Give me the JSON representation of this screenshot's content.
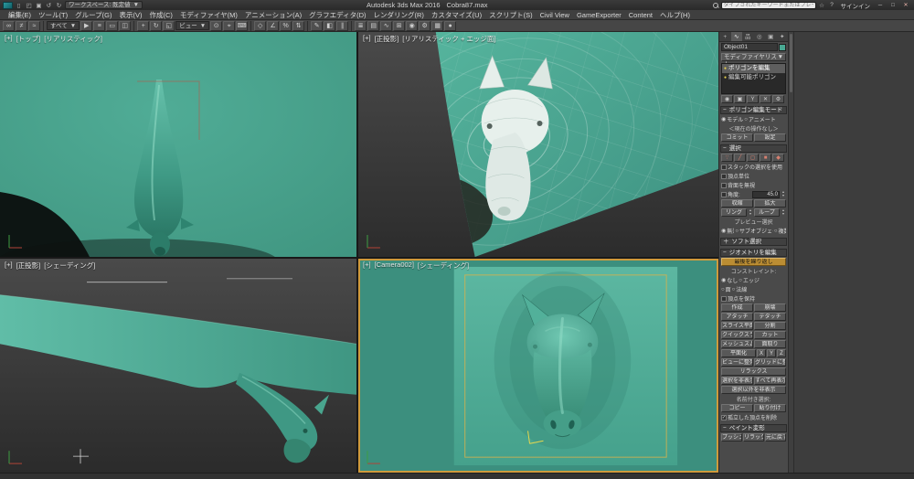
{
  "palette": {
    "chrome": "#3c3c3c",
    "viewport_teal": "#47a28d",
    "viewport_teal_dark": "#35826f",
    "active_viewport_border": "#cf9a3c",
    "panel_gray": "#4a4a4a",
    "object_color": "#49a892",
    "safe_frame_yellow": "#d3b24e"
  },
  "titlebar": {
    "product": "Autodesk 3ds Max 2016",
    "filename": "Cobra87.max",
    "workspace_label": "ワークスペース: 既定値",
    "search_placeholder": "タイプされたキーワードまたはフレーズ",
    "signin_label": "サインイン",
    "quick": {
      "new": "▯",
      "open": "◰",
      "save": "▣",
      "undo": "↺",
      "redo": "↻"
    },
    "star_icon": "☆",
    "help_icon": "?",
    "window": {
      "minimize": "─",
      "maximize": "□",
      "close": "✕"
    }
  },
  "menubar": {
    "items": [
      "編集(E)",
      "ツール(T)",
      "グループ(G)",
      "表示(V)",
      "作成(C)",
      "モディファイヤ(M)",
      "アニメーション(A)",
      "グラフエディタ(D)",
      "レンダリング(R)",
      "カスタマイズ(U)",
      "スクリプト(S)",
      "Civil View",
      "GameExporter",
      "Content",
      "ヘルプ(H)"
    ]
  },
  "toolbar": {
    "filter_label": "すべて",
    "refcoord_label": "ビュー",
    "icons": [
      {
        "name": "select-and-link",
        "glyph": "∞"
      },
      {
        "name": "unlink-selection",
        "glyph": "≠"
      },
      {
        "name": "bind-to-space-warp",
        "glyph": "≈"
      },
      {
        "name": "select-object",
        "glyph": "▶"
      },
      {
        "name": "select-by-name",
        "glyph": "≡"
      },
      {
        "name": "rectangular-selection-region",
        "glyph": "▭"
      },
      {
        "name": "window-crossing",
        "glyph": "◫"
      },
      {
        "name": "select-and-move",
        "glyph": "+"
      },
      {
        "name": "select-and-rotate",
        "glyph": "↻"
      },
      {
        "name": "select-and-scale",
        "glyph": "◱"
      },
      {
        "name": "use-pivot-point-center",
        "glyph": "⊙"
      },
      {
        "name": "select-and-manipulate",
        "glyph": "⌖"
      },
      {
        "name": "keyboard-shortcut-override",
        "glyph": "⌨"
      },
      {
        "name": "snaps-toggle",
        "glyph": "◇"
      },
      {
        "name": "angle-snap-toggle",
        "glyph": "∠"
      },
      {
        "name": "percent-snap-toggle",
        "glyph": "%"
      },
      {
        "name": "spinner-snap-toggle",
        "glyph": "⇅"
      },
      {
        "name": "edit-named-selection-sets",
        "glyph": "✎"
      },
      {
        "name": "mirror",
        "glyph": "◧"
      },
      {
        "name": "align",
        "glyph": "∥"
      },
      {
        "name": "toggle-scene-explorer",
        "glyph": "≣"
      },
      {
        "name": "toggle-ribbon",
        "glyph": "▤"
      },
      {
        "name": "curve-editor",
        "glyph": "∿"
      },
      {
        "name": "schematic-view",
        "glyph": "⊞"
      },
      {
        "name": "material-editor",
        "glyph": "◉"
      },
      {
        "name": "render-setup",
        "glyph": "⚙"
      },
      {
        "name": "rendered-frame-window",
        "glyph": "▦"
      },
      {
        "name": "render-production",
        "glyph": "●"
      }
    ]
  },
  "viewports": {
    "top_left": {
      "menu": "[+]",
      "view": "[トップ]",
      "shading": "[リアリスティック]"
    },
    "top_right": {
      "menu": "[+]",
      "view": "[正投影]",
      "shading": "[リアリスティック + エッジ面]"
    },
    "bottom_left": {
      "menu": "[+]",
      "view": "[正投影]",
      "shading": "[シェーディング]"
    },
    "bottom_right": {
      "menu": "[+]",
      "view": "[Camera002]",
      "shading": "[シェーディング]"
    }
  },
  "command_panel": {
    "tabs": [
      {
        "name": "create",
        "glyph": "+"
      },
      {
        "name": "modify",
        "glyph": "∿"
      },
      {
        "name": "hierarchy",
        "glyph": "品"
      },
      {
        "name": "motion",
        "glyph": "◎"
      },
      {
        "name": "display",
        "glyph": "▣"
      },
      {
        "name": "utilities",
        "glyph": "✦"
      }
    ],
    "object_name": "Object01",
    "modifier_list_label": "モディファイヤリスト",
    "stack": [
      {
        "label": "ポリゴンを編集",
        "selected": true
      },
      {
        "label": "編集可能ポリゴン",
        "selected": false
      }
    ],
    "stack_buttons": [
      {
        "name": "pin-stack",
        "glyph": "◉"
      },
      {
        "name": "show-end-result",
        "glyph": "▣"
      },
      {
        "name": "make-unique",
        "glyph": "Y"
      },
      {
        "name": "remove-modifier",
        "glyph": "✕"
      },
      {
        "name": "configure-modifier-sets",
        "glyph": "⚙"
      }
    ],
    "rollouts": {
      "edit_poly_mode": {
        "collapse": "−",
        "title": "ポリゴン編集モード",
        "model": "モデル",
        "animate": "アニメート",
        "current_op": "＜現在の操作なし＞",
        "commit": "コミット",
        "settings": "設定"
      },
      "selection": {
        "collapse": "−",
        "title": "選択",
        "sub_objects": [
          {
            "name": "vertex",
            "glyph": "∵"
          },
          {
            "name": "edge",
            "glyph": "╱"
          },
          {
            "name": "border",
            "glyph": "◻"
          },
          {
            "name": "polygon",
            "glyph": "■"
          },
          {
            "name": "element",
            "glyph": "◆"
          }
        ],
        "use_stack": "スタックの選択を使用",
        "by_vertex": "頂点単位",
        "ignore_backfacing": "背面を無視",
        "angle_label": "角度:",
        "angle_value": "45.0",
        "shrink": "収縮",
        "grow": "拡大",
        "ring": "リング",
        "loop": "ループ",
        "preview_label": "プレビュー選択",
        "preview_off": "無効",
        "preview_subobj": "サブオブジェクト",
        "preview_multi": "複数"
      },
      "soft_selection": {
        "collapse": "＋",
        "title": "ソフト選択"
      },
      "edit_geometry": {
        "collapse": "−",
        "title": "ジオメトリを編集",
        "repeat_last": "最後を繰り返し",
        "constraints_label": "コンストレイント:",
        "c_none": "なし",
        "c_edge": "エッジ",
        "c_face": "面",
        "c_normal": "法線",
        "preserve_uvs": "頂点を保持",
        "create": "作成",
        "collapse_btn": "崩壊",
        "attach": "アタッチ",
        "detach": "デタッチ",
        "slice_plane": "スライス平面",
        "split": "分割",
        "quick_slice": "クイックスライス",
        "cut": "カット",
        "msmooth": "メッシュスムーズ",
        "chamfer": "面取り",
        "make_planar": "平面化",
        "x": "X",
        "y": "Y",
        "z": "Z",
        "view_align": "ビューに整列",
        "grid_align": "グリッドに整列",
        "relax": "リラックス",
        "hide_selected": "選択を非表示",
        "unhide_all": "すべて再表示",
        "hide_unselected": "選択以外を非表示",
        "named_label": "名前付き選択:",
        "copy": "コピー",
        "paste": "貼り付け",
        "delete_isolated": "孤立した頂点を削除"
      },
      "paint_deform": {
        "collapse": "−",
        "title": "ペイント変形",
        "push_pull": "プッシュ/プル",
        "relax": "リラックス",
        "revert": "元に戻す"
      }
    }
  },
  "ui": {
    "dropdown_arrow": "▼",
    "spinner_up": "▲",
    "spinner_down": "▼",
    "radio_on": "◉",
    "radio_off": "○",
    "check": "✓",
    "bulb": "●"
  }
}
